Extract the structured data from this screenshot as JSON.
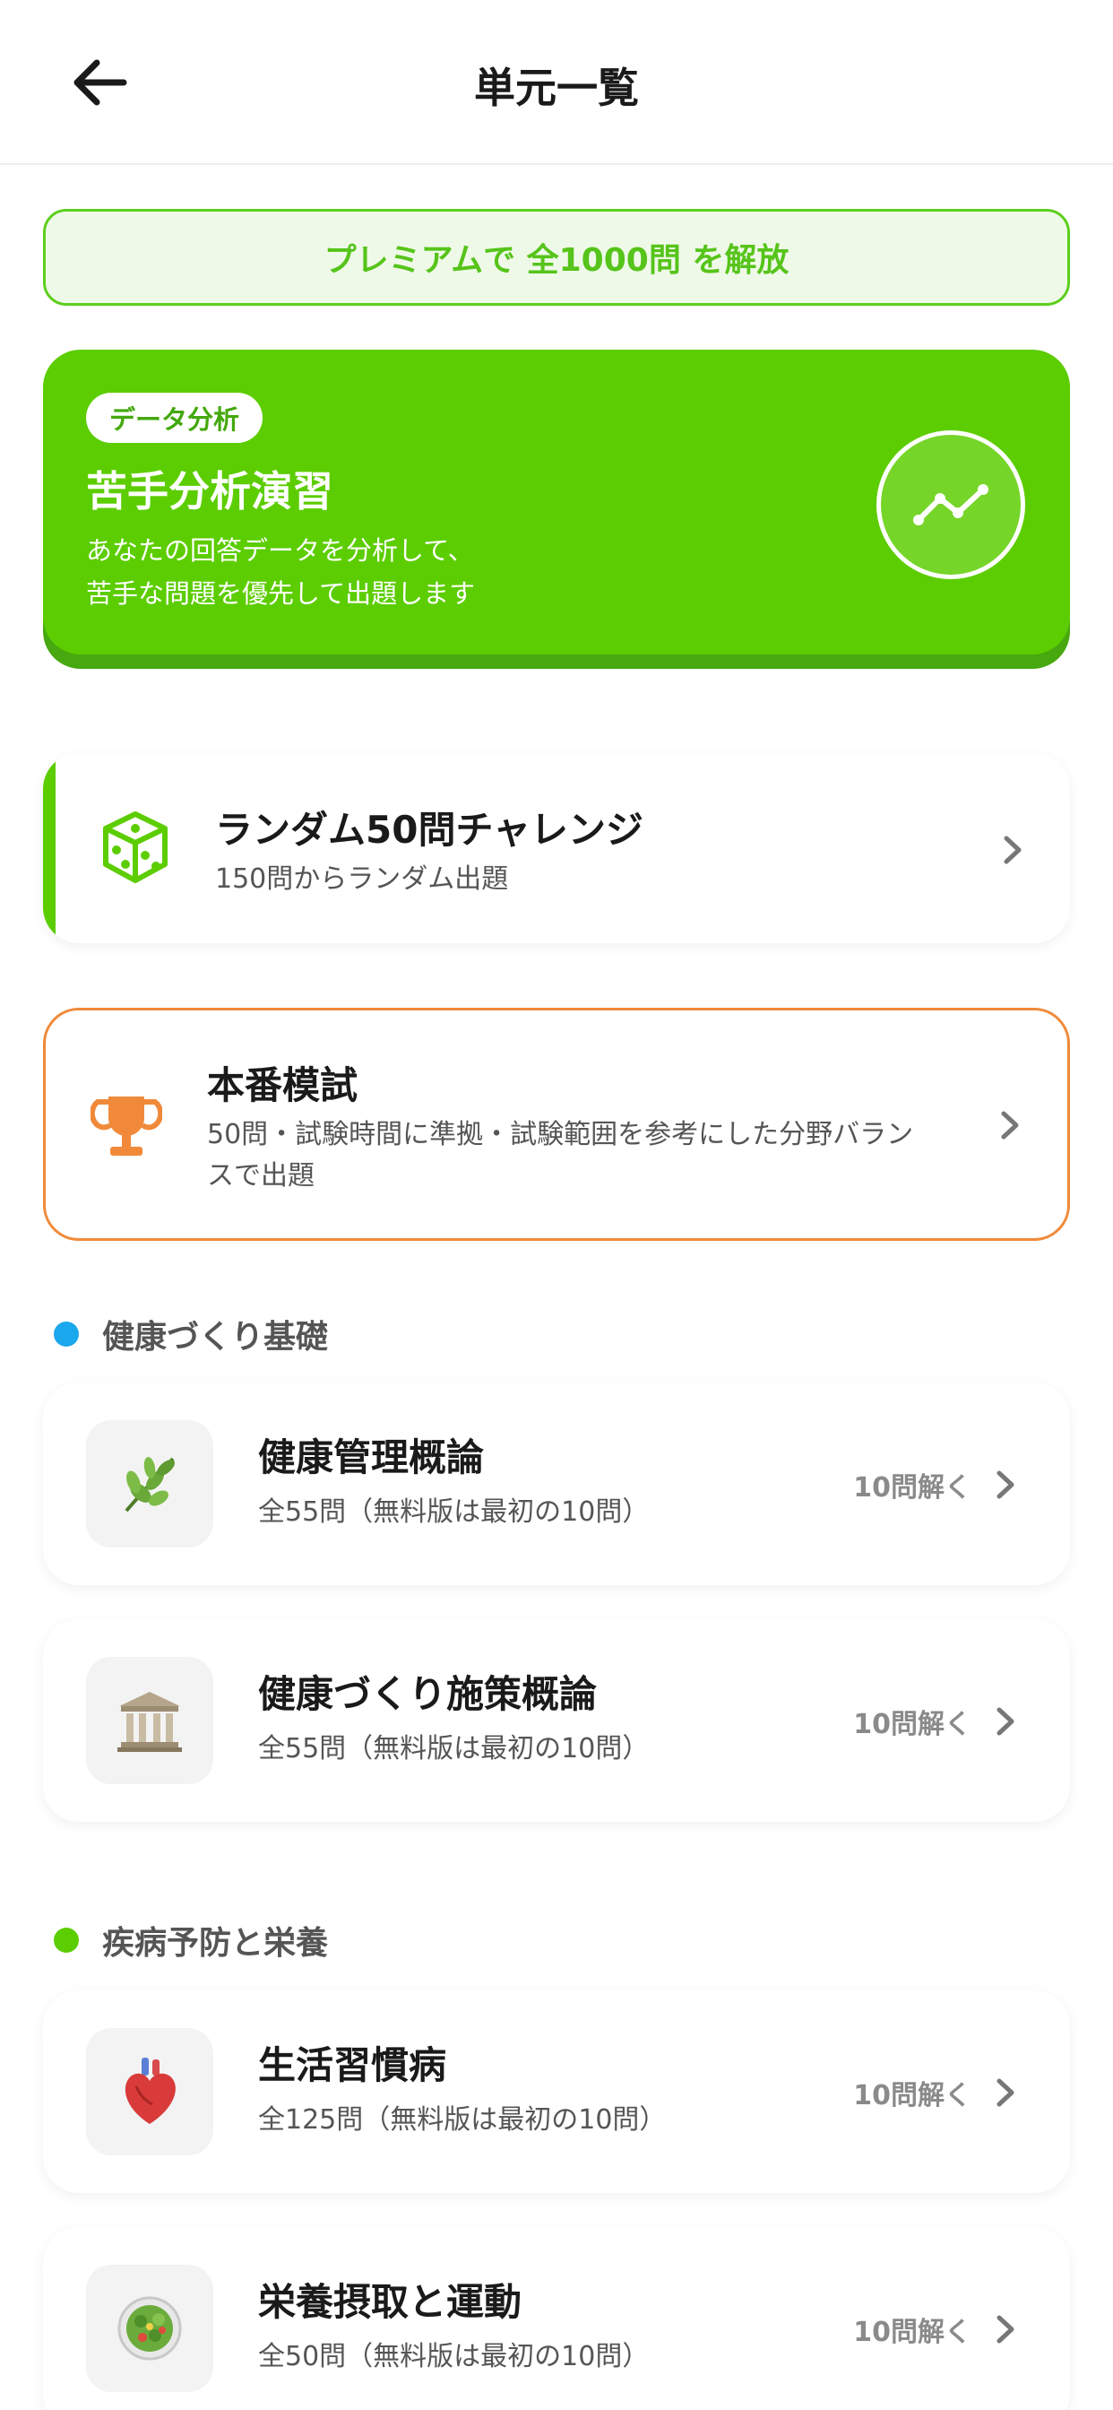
{
  "header": {
    "title": "単元一覧",
    "back_icon": "arrow-left-icon"
  },
  "premium_banner": {
    "text": "プレミアムで 全1000問 を解放"
  },
  "analysis_card": {
    "badge": "データ分析",
    "title": "苦手分析演習",
    "description_line1": "あなたの回答データを分析して、",
    "description_line2": "苦手な問題を優先して出題します",
    "icon": "trend-line-icon"
  },
  "random_card": {
    "title": "ランダム50問チャレンジ",
    "subtitle": "150問からランダム出題",
    "icon": "dice-icon"
  },
  "exam_card": {
    "title": "本番模試",
    "subtitle_line1": "50問・試験時間に準拠・試験範囲を参考にした分野バラン",
    "subtitle_line2": "スで出題",
    "icon": "trophy-icon"
  },
  "sections": [
    {
      "label": "健康づくり基礎",
      "dot_color": "#1aa7ec",
      "units": [
        {
          "title": "健康管理概論",
          "subtitle": "全55問（無料版は最初の10問）",
          "action": "10問解く",
          "icon": "herb-icon"
        },
        {
          "title": "健康づくり施策概論",
          "subtitle": "全55問（無料版は最初の10問）",
          "action": "10問解く",
          "icon": "classical-building-icon"
        }
      ]
    },
    {
      "label": "疾病予防と栄養",
      "dot_color": "#5ccd00",
      "units": [
        {
          "title": "生活習慣病",
          "subtitle": "全125問（無料版は最初の10問）",
          "action": "10問解く",
          "icon": "anatomical-heart-icon"
        },
        {
          "title": "栄養摂取と運動",
          "subtitle": "全50問（無料版は最初の10問）",
          "action": "10問解く",
          "icon": "salad-icon"
        }
      ]
    }
  ],
  "colors": {
    "accent_green": "#5ccd00",
    "exam_orange": "#f08a3a",
    "section_blue": "#1aa7ec"
  }
}
